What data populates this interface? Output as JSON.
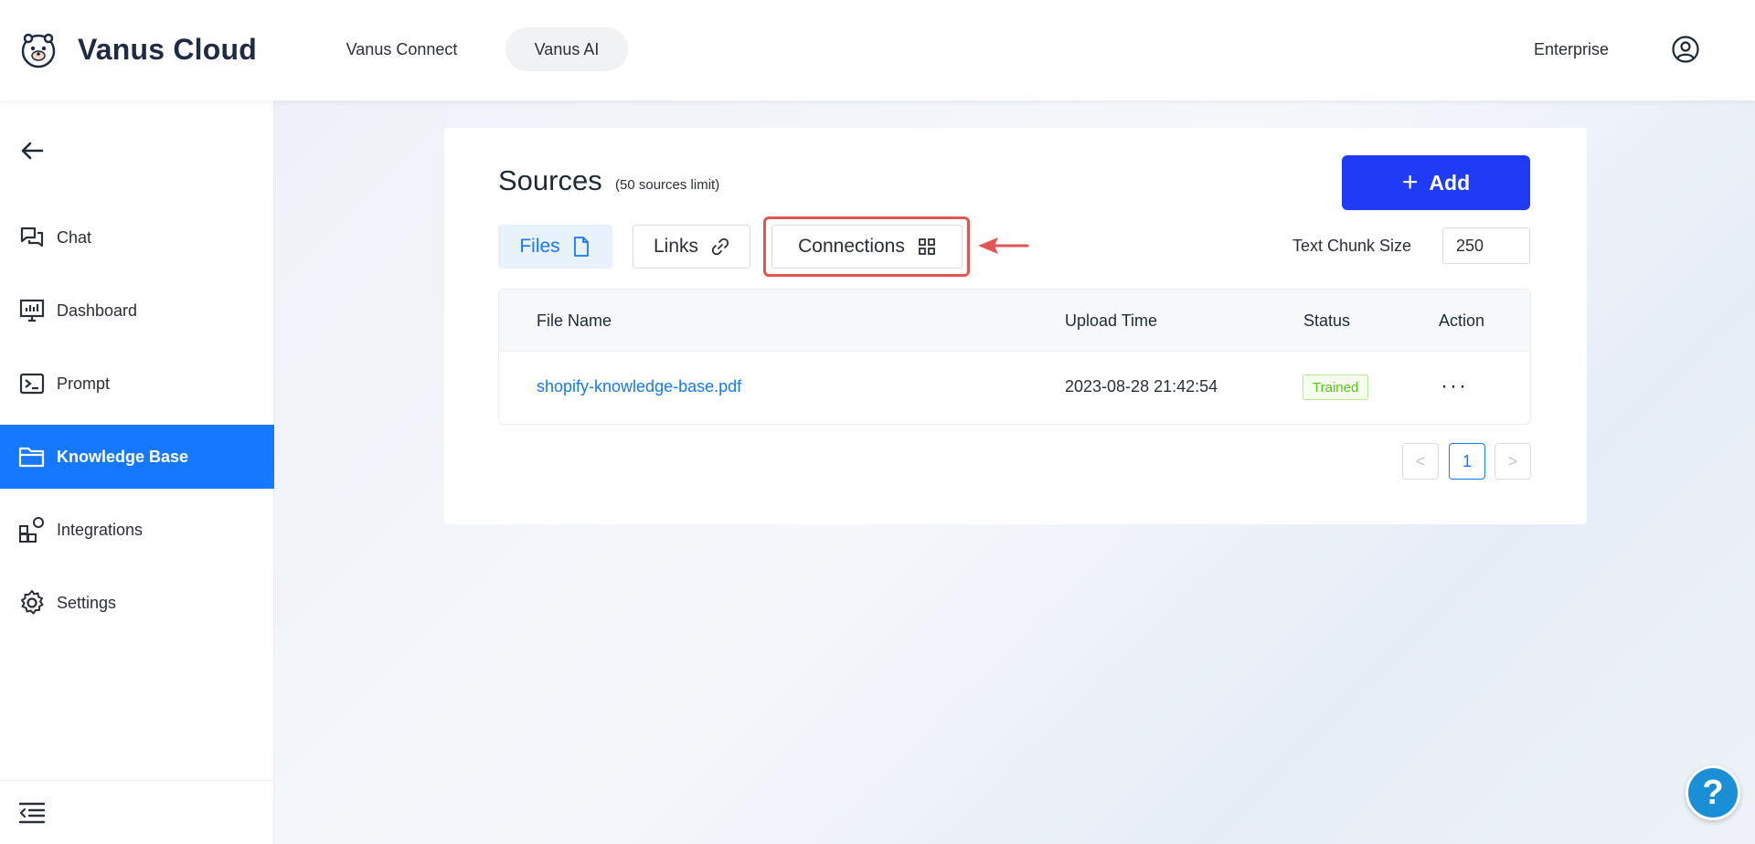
{
  "header": {
    "brand": "Vanus Cloud",
    "nav": [
      {
        "label": "Vanus Connect",
        "active": false
      },
      {
        "label": "Vanus AI",
        "active": true
      }
    ],
    "plan": "Enterprise",
    "icons": {
      "logo": "otter-logo",
      "user": "user-circle-icon"
    }
  },
  "sidebar": {
    "items": [
      {
        "label": "Chat",
        "icon": "chat-icon",
        "active": false
      },
      {
        "label": "Dashboard",
        "icon": "dashboard-icon",
        "active": false
      },
      {
        "label": "Prompt",
        "icon": "terminal-icon",
        "active": false
      },
      {
        "label": "Knowledge Base",
        "icon": "folder-icon",
        "active": true
      },
      {
        "label": "Integrations",
        "icon": "integrations-icon",
        "active": false
      },
      {
        "label": "Settings",
        "icon": "gear-icon",
        "active": false
      }
    ],
    "accent": "#1677ff"
  },
  "sources": {
    "title": "Sources",
    "limit": "(50 sources limit)",
    "add_label": "Add",
    "tabs": [
      {
        "label": "Files",
        "icon": "file-icon",
        "active": true
      },
      {
        "label": "Links",
        "icon": "link-icon",
        "active": false
      },
      {
        "label": "Connections",
        "icon": "grid-icon",
        "active": false
      }
    ],
    "chunk_label": "Text Chunk Size",
    "chunk_value": "250"
  },
  "table": {
    "columns": [
      "File Name",
      "Upload Time",
      "Status",
      "Action"
    ],
    "rows": [
      {
        "file": "shopify-knowledge-base.pdf",
        "time": "2023-08-28 21:42:54",
        "status": "Trained",
        "action": "···"
      }
    ]
  },
  "pagination": {
    "prev": "<",
    "current": "1",
    "next": ">"
  },
  "help": "?",
  "colors": {
    "primary_button": "#1f3bf5",
    "highlight": "#e15555",
    "status_green": "#52c41a"
  }
}
